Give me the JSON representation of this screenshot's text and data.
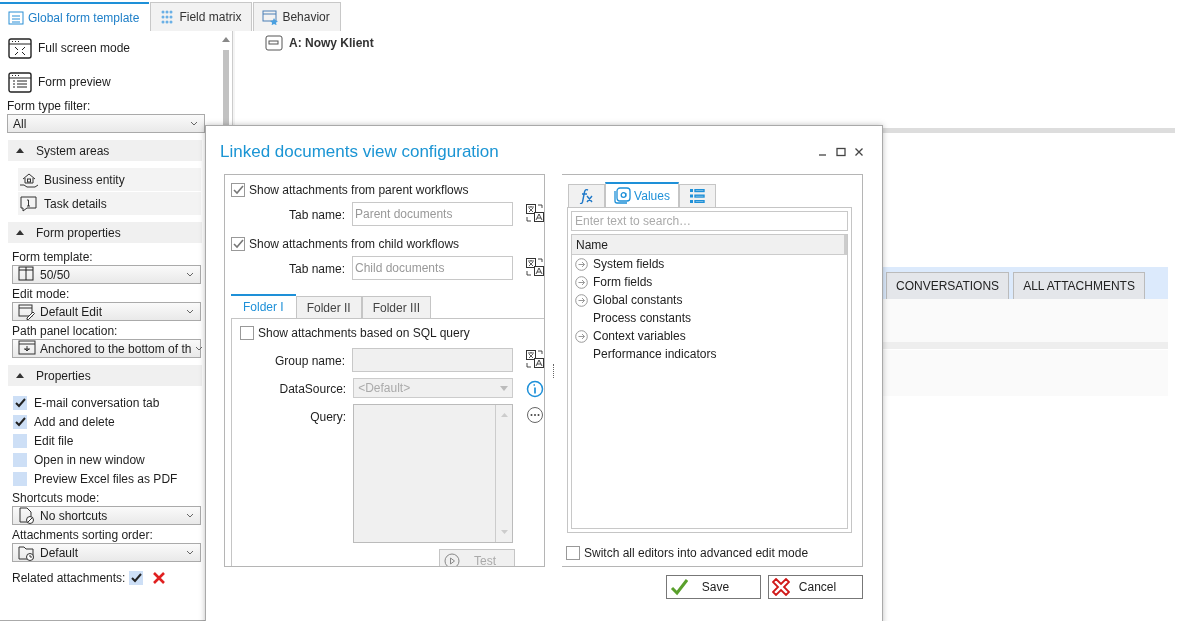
{
  "top_tabs": [
    {
      "label": "Global form template",
      "selected": true
    },
    {
      "label": "Field matrix",
      "selected": false
    },
    {
      "label": "Behavior",
      "selected": false
    }
  ],
  "sidebar": {
    "actions": [
      {
        "label": "Full screen mode"
      },
      {
        "label": "Form preview"
      }
    ],
    "filter": {
      "label": "Form type filter:",
      "value": "All"
    },
    "sections": [
      {
        "title": "System areas",
        "expanded": true,
        "rows": [
          {
            "kind": "item",
            "label": "Business entity"
          },
          {
            "kind": "item",
            "label": "Task details"
          }
        ]
      },
      {
        "title": "Form properties",
        "expanded": true,
        "rows": [
          {
            "kind": "select",
            "label": "Form template:",
            "value": "50/50"
          },
          {
            "kind": "select",
            "label": "Edit mode:",
            "value": "Default Edit"
          },
          {
            "kind": "select",
            "label": "Path panel location:",
            "value": "Anchored to the bottom of th"
          }
        ]
      },
      {
        "title": "Properties",
        "expanded": true,
        "rows": [
          {
            "kind": "check",
            "label": "E-mail conversation tab",
            "checked": true
          },
          {
            "kind": "check",
            "label": "Add and delete",
            "checked": true
          },
          {
            "kind": "check",
            "label": "Edit file",
            "checked": false
          },
          {
            "kind": "check",
            "label": "Open in new window",
            "checked": false
          },
          {
            "kind": "check",
            "label": "Preview Excel files as PDF",
            "checked": false
          },
          {
            "kind": "select",
            "label": "Shortcuts mode:",
            "value": "No shortcuts"
          },
          {
            "kind": "select",
            "label": "Attachments sorting order:",
            "value": "Default"
          },
          {
            "kind": "related",
            "label": "Related attachments:",
            "checked": true
          }
        ]
      }
    ]
  },
  "canvas": {
    "tree_item": "A: Nowy Klient",
    "record_tabs": [
      {
        "label": "CONVERSATIONS"
      },
      {
        "label": "ALL ATTACHMENTS"
      }
    ]
  },
  "dialog": {
    "title": "Linked documents view configuration",
    "sources": [
      {
        "label": "Show attachments from parent workflows",
        "checked": true,
        "tab_label": "Tab name:",
        "tab_placeholder": "Parent documents"
      },
      {
        "label": "Show attachments from child workflows",
        "checked": true,
        "tab_label": "Tab name:",
        "tab_placeholder": "Child documents"
      }
    ],
    "folder_tabs": [
      {
        "label": "Folder I",
        "selected": true
      },
      {
        "label": "Folder II",
        "selected": false
      },
      {
        "label": "Folder III",
        "selected": false
      }
    ],
    "sql": {
      "label": "Show attachments based on SQL query",
      "checked": false
    },
    "group_name": {
      "label": "Group name:",
      "disabled": true
    },
    "datasource": {
      "label": "DataSource:",
      "value": "<Default>",
      "disabled": true
    },
    "query": {
      "label": "Query:",
      "disabled": true
    },
    "test_button": {
      "label": "Test",
      "disabled": true
    },
    "editor_tabs": [
      {
        "kind": "function",
        "selected": false
      },
      {
        "kind": "values",
        "label": "Values",
        "selected": true
      },
      {
        "kind": "list",
        "selected": false
      }
    ],
    "search_placeholder": "Enter text to search…",
    "values_list": {
      "header": "Name",
      "items": [
        {
          "label": "System fields",
          "expandable": true
        },
        {
          "label": "Form fields",
          "expandable": true
        },
        {
          "label": "Global constants",
          "expandable": true
        },
        {
          "label": "Process constants",
          "expandable": false
        },
        {
          "label": "Context variables",
          "expandable": true
        },
        {
          "label": "Performance indicators",
          "expandable": false
        }
      ]
    },
    "advanced_mode": {
      "label": "Switch all editors into advanced edit mode",
      "checked": false
    },
    "buttons": [
      {
        "kind": "save",
        "label": "Save"
      },
      {
        "kind": "cancel",
        "label": "Cancel"
      }
    ]
  }
}
